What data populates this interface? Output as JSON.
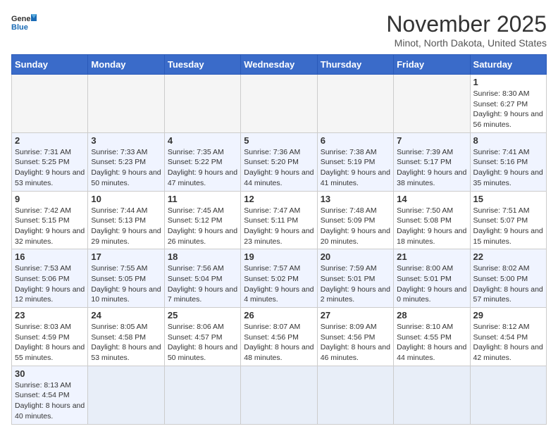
{
  "logo": {
    "general": "General",
    "blue": "Blue"
  },
  "title": "November 2025",
  "location": "Minot, North Dakota, United States",
  "weekdays": [
    "Sunday",
    "Monday",
    "Tuesday",
    "Wednesday",
    "Thursday",
    "Friday",
    "Saturday"
  ],
  "weeks": [
    [
      {
        "day": "",
        "info": ""
      },
      {
        "day": "",
        "info": ""
      },
      {
        "day": "",
        "info": ""
      },
      {
        "day": "",
        "info": ""
      },
      {
        "day": "",
        "info": ""
      },
      {
        "day": "",
        "info": ""
      },
      {
        "day": "1",
        "info": "Sunrise: 8:30 AM\nSunset: 6:27 PM\nDaylight: 9 hours and 56 minutes."
      }
    ],
    [
      {
        "day": "2",
        "info": "Sunrise: 7:31 AM\nSunset: 5:25 PM\nDaylight: 9 hours and 53 minutes."
      },
      {
        "day": "3",
        "info": "Sunrise: 7:33 AM\nSunset: 5:23 PM\nDaylight: 9 hours and 50 minutes."
      },
      {
        "day": "4",
        "info": "Sunrise: 7:35 AM\nSunset: 5:22 PM\nDaylight: 9 hours and 47 minutes."
      },
      {
        "day": "5",
        "info": "Sunrise: 7:36 AM\nSunset: 5:20 PM\nDaylight: 9 hours and 44 minutes."
      },
      {
        "day": "6",
        "info": "Sunrise: 7:38 AM\nSunset: 5:19 PM\nDaylight: 9 hours and 41 minutes."
      },
      {
        "day": "7",
        "info": "Sunrise: 7:39 AM\nSunset: 5:17 PM\nDaylight: 9 hours and 38 minutes."
      },
      {
        "day": "8",
        "info": "Sunrise: 7:41 AM\nSunset: 5:16 PM\nDaylight: 9 hours and 35 minutes."
      }
    ],
    [
      {
        "day": "9",
        "info": "Sunrise: 7:42 AM\nSunset: 5:15 PM\nDaylight: 9 hours and 32 minutes."
      },
      {
        "day": "10",
        "info": "Sunrise: 7:44 AM\nSunset: 5:13 PM\nDaylight: 9 hours and 29 minutes."
      },
      {
        "day": "11",
        "info": "Sunrise: 7:45 AM\nSunset: 5:12 PM\nDaylight: 9 hours and 26 minutes."
      },
      {
        "day": "12",
        "info": "Sunrise: 7:47 AM\nSunset: 5:11 PM\nDaylight: 9 hours and 23 minutes."
      },
      {
        "day": "13",
        "info": "Sunrise: 7:48 AM\nSunset: 5:09 PM\nDaylight: 9 hours and 20 minutes."
      },
      {
        "day": "14",
        "info": "Sunrise: 7:50 AM\nSunset: 5:08 PM\nDaylight: 9 hours and 18 minutes."
      },
      {
        "day": "15",
        "info": "Sunrise: 7:51 AM\nSunset: 5:07 PM\nDaylight: 9 hours and 15 minutes."
      }
    ],
    [
      {
        "day": "16",
        "info": "Sunrise: 7:53 AM\nSunset: 5:06 PM\nDaylight: 9 hours and 12 minutes."
      },
      {
        "day": "17",
        "info": "Sunrise: 7:55 AM\nSunset: 5:05 PM\nDaylight: 9 hours and 10 minutes."
      },
      {
        "day": "18",
        "info": "Sunrise: 7:56 AM\nSunset: 5:04 PM\nDaylight: 9 hours and 7 minutes."
      },
      {
        "day": "19",
        "info": "Sunrise: 7:57 AM\nSunset: 5:02 PM\nDaylight: 9 hours and 4 minutes."
      },
      {
        "day": "20",
        "info": "Sunrise: 7:59 AM\nSunset: 5:01 PM\nDaylight: 9 hours and 2 minutes."
      },
      {
        "day": "21",
        "info": "Sunrise: 8:00 AM\nSunset: 5:01 PM\nDaylight: 9 hours and 0 minutes."
      },
      {
        "day": "22",
        "info": "Sunrise: 8:02 AM\nSunset: 5:00 PM\nDaylight: 8 hours and 57 minutes."
      }
    ],
    [
      {
        "day": "23",
        "info": "Sunrise: 8:03 AM\nSunset: 4:59 PM\nDaylight: 8 hours and 55 minutes."
      },
      {
        "day": "24",
        "info": "Sunrise: 8:05 AM\nSunset: 4:58 PM\nDaylight: 8 hours and 53 minutes."
      },
      {
        "day": "25",
        "info": "Sunrise: 8:06 AM\nSunset: 4:57 PM\nDaylight: 8 hours and 50 minutes."
      },
      {
        "day": "26",
        "info": "Sunrise: 8:07 AM\nSunset: 4:56 PM\nDaylight: 8 hours and 48 minutes."
      },
      {
        "day": "27",
        "info": "Sunrise: 8:09 AM\nSunset: 4:56 PM\nDaylight: 8 hours and 46 minutes."
      },
      {
        "day": "28",
        "info": "Sunrise: 8:10 AM\nSunset: 4:55 PM\nDaylight: 8 hours and 44 minutes."
      },
      {
        "day": "29",
        "info": "Sunrise: 8:12 AM\nSunset: 4:54 PM\nDaylight: 8 hours and 42 minutes."
      }
    ],
    [
      {
        "day": "30",
        "info": "Sunrise: 8:13 AM\nSunset: 4:54 PM\nDaylight: 8 hours and 40 minutes."
      },
      {
        "day": "",
        "info": ""
      },
      {
        "day": "",
        "info": ""
      },
      {
        "day": "",
        "info": ""
      },
      {
        "day": "",
        "info": ""
      },
      {
        "day": "",
        "info": ""
      },
      {
        "day": "",
        "info": ""
      }
    ]
  ]
}
